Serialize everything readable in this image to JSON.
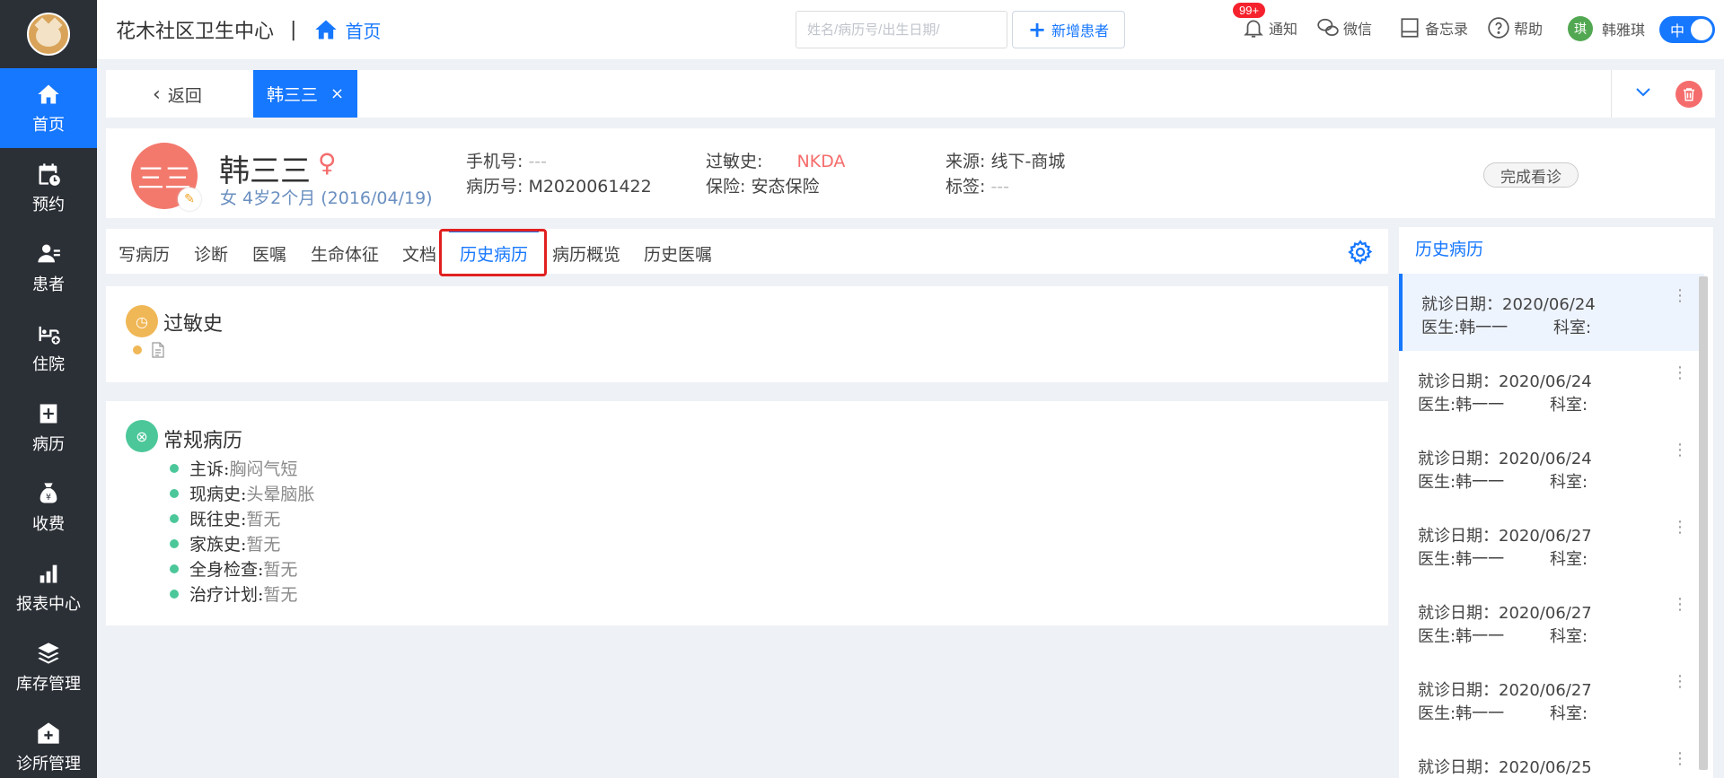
{
  "app": {
    "clinic_name": "花木社区卫生中心",
    "home_label": "首页"
  },
  "sidebar": {
    "items": [
      {
        "label": "首页",
        "icon": "home-icon"
      },
      {
        "label": "预约",
        "icon": "calendar-icon"
      },
      {
        "label": "患者",
        "icon": "patient-icon"
      },
      {
        "label": "住院",
        "icon": "bed-icon"
      },
      {
        "label": "病历",
        "icon": "medical-record-icon"
      },
      {
        "label": "收费",
        "icon": "money-bag-icon"
      },
      {
        "label": "报表中心",
        "icon": "bar-chart-icon"
      },
      {
        "label": "库存管理",
        "icon": "layers-icon"
      },
      {
        "label": "诊所管理",
        "icon": "clinic-icon"
      }
    ]
  },
  "header": {
    "search_placeholder": "姓名/病历号/出生日期/",
    "new_patient_label": "新增患者",
    "notify_label": "通知",
    "notify_badge": "99+",
    "wechat_label": "微信",
    "memo_label": "备忘录",
    "help_label": "帮助",
    "user_initial": "琪",
    "user_name": "韩雅琪",
    "lang_label": "中"
  },
  "tabs": {
    "back_label": "返回",
    "patient_tab": "韩三三",
    "close_symbol": "×"
  },
  "patient": {
    "avatar_text": "三三",
    "name": "韩三三",
    "sub": "女  4岁2个月  (2016/04/19)",
    "phone_label": "手机号:",
    "phone_value": "---",
    "record_label": "病历号:",
    "record_value": "M2020061422",
    "allergy_label": "过敏史:",
    "allergy_value": "NKDA",
    "insurance_label": "保险:",
    "insurance_value": "安态保险",
    "source_label": "来源:",
    "source_value": "线下-商城",
    "tag_label": "标签:",
    "tag_value": "---",
    "finish_label": "完成看诊"
  },
  "record_tabs": [
    "写病历",
    "诊断",
    "医嘱",
    "生命体征",
    "文档",
    "历史病历",
    "病历概览",
    "历史医嘱"
  ],
  "allergy_section": {
    "title": "过敏史"
  },
  "general_section": {
    "title": "常规病历",
    "fields": [
      {
        "label": "主诉:",
        "value": "胸闷气短"
      },
      {
        "label": "现病史:",
        "value": "头晕脑胀"
      },
      {
        "label": "既往史:",
        "value": "暂无"
      },
      {
        "label": "家族史:",
        "value": "暂无"
      },
      {
        "label": "全身检查:",
        "value": "暂无"
      },
      {
        "label": "治疗计划:",
        "value": "暂无"
      }
    ]
  },
  "history": {
    "title": "历史病历",
    "items": [
      {
        "date": "就诊日期：2020/06/24",
        "doctor": "医生:韩一一",
        "dept": "科室:"
      },
      {
        "date": "就诊日期：2020/06/24",
        "doctor": "医生:韩一一",
        "dept": "科室:"
      },
      {
        "date": "就诊日期：2020/06/24",
        "doctor": "医生:韩一一",
        "dept": "科室:"
      },
      {
        "date": "就诊日期：2020/06/27",
        "doctor": "医生:韩一一",
        "dept": "科室:"
      },
      {
        "date": "就诊日期：2020/06/27",
        "doctor": "医生:韩一一",
        "dept": "科室:"
      },
      {
        "date": "就诊日期：2020/06/27",
        "doctor": "医生:韩一一",
        "dept": "科室:"
      },
      {
        "date": "就诊日期：2020/06/25",
        "doctor": "",
        "dept": ""
      }
    ]
  },
  "colors": {
    "primary": "#1677ff",
    "sidebar_bg": "#2b2f36",
    "danger": "#f56c6c",
    "allergy_icon": "#f0b756",
    "general_icon": "#4cc79a"
  }
}
